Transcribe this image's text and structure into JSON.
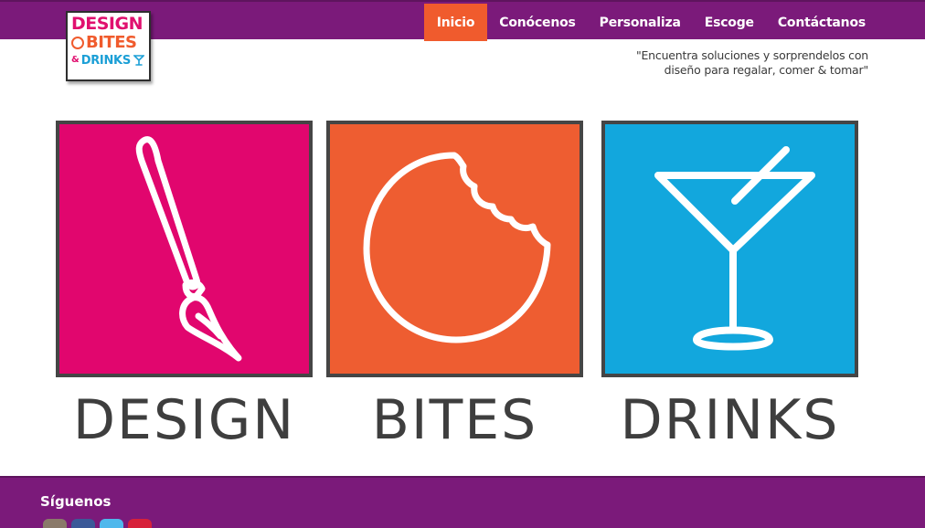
{
  "nav": {
    "items": [
      {
        "label": "Inicio",
        "active": true
      },
      {
        "label": "Conócenos",
        "active": false
      },
      {
        "label": "Personaliza",
        "active": false
      },
      {
        "label": "Escoge",
        "active": false
      },
      {
        "label": "Contáctanos",
        "active": false
      }
    ]
  },
  "logo": {
    "line1": "DESIGN",
    "line2": "BITES",
    "line3_amp": "&",
    "line3": "DRINKS"
  },
  "tagline": {
    "line1": "\"Encuentra soluciones y sorprendelos con",
    "line2": "diseño para regalar, comer & tomar\""
  },
  "tiles": [
    {
      "label": "DESIGN",
      "icon": "paintbrush-icon",
      "color": "#e1066e"
    },
    {
      "label": "BITES",
      "icon": "bitten-cookie-icon",
      "color": "#ee5d31"
    },
    {
      "label": "DRINKS",
      "icon": "cocktail-glass-icon",
      "color": "#12a7dd"
    }
  ],
  "footer": {
    "follow_label": "Síguenos",
    "socials": [
      {
        "icon": "instagram-icon"
      },
      {
        "icon": "facebook-icon"
      },
      {
        "icon": "twitter-icon"
      },
      {
        "icon": "pinterest-icon"
      }
    ]
  },
  "colors": {
    "brand_purple": "#7b1a7a",
    "active_orange": "#f05b2d",
    "design_pink": "#e1066e",
    "bites_orange": "#ee5d31",
    "drinks_blue": "#12a7dd"
  }
}
